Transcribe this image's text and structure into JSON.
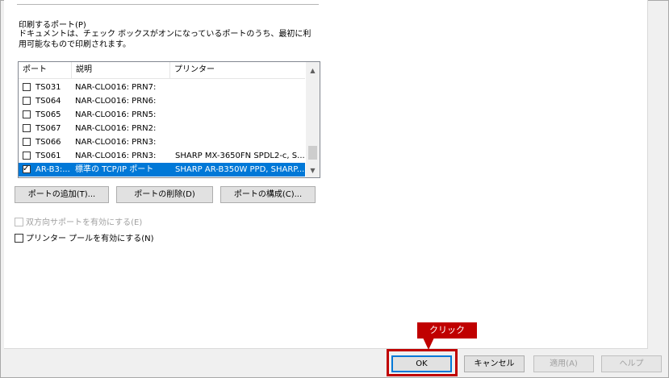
{
  "ports_section": {
    "title": "印刷するポート(P)",
    "description": "ドキュメントは、チェック ボックスがオンになっているポートのうち、最初に利用可能なもので印刷されます。"
  },
  "port_list": {
    "columns": [
      "ポート",
      "説明",
      "プリンター"
    ],
    "rows": [
      {
        "port": "TS031",
        "desc": "NAR-CLO016:  PRN7:",
        "printer": "",
        "checked": false,
        "selected": false
      },
      {
        "port": "TS064",
        "desc": "NAR-CLO016:  PRN6:",
        "printer": "",
        "checked": false,
        "selected": false
      },
      {
        "port": "TS065",
        "desc": "NAR-CLO016:  PRN5:",
        "printer": "",
        "checked": false,
        "selected": false
      },
      {
        "port": "TS067",
        "desc": "NAR-CLO016:  PRN2:",
        "printer": "",
        "checked": false,
        "selected": false
      },
      {
        "port": "TS066",
        "desc": "NAR-CLO016:  PRN3:",
        "printer": "",
        "checked": false,
        "selected": false
      },
      {
        "port": "TS061",
        "desc": "NAR-CLO016:  PRN3:",
        "printer": "SHARP MX-3650FN SPDL2-c, S...",
        "checked": false,
        "selected": false
      },
      {
        "port": "AR-B3:...",
        "desc": "標準の TCP/IP ポート",
        "printer": "SHARP AR-B350W PPD, SHARP...",
        "checked": true,
        "selected": true
      }
    ]
  },
  "port_buttons": {
    "add": "ポートの追加(T)...",
    "delete": "ポートの削除(D)",
    "configure": "ポートの構成(C)..."
  },
  "options": {
    "bidirectional": {
      "label": "双方向サポートを有効にする(E)",
      "checked": false,
      "enabled": false
    },
    "pooling": {
      "label": "プリンター プールを有効にする(N)",
      "checked": false,
      "enabled": true
    }
  },
  "dialog_buttons": {
    "ok": "OK",
    "cancel": "キャンセル",
    "apply": "適用(A)",
    "help": "ヘルプ"
  },
  "annotation": {
    "callout_text": "クリック",
    "color": "#c00000"
  },
  "icons": {
    "scroll_up": "chevron-up-icon",
    "scroll_down": "chevron-down-icon",
    "check": "checkmark-icon"
  },
  "colors": {
    "selection": "#0078d7",
    "panel": "#ffffff",
    "dialog": "#f0f0f0"
  }
}
